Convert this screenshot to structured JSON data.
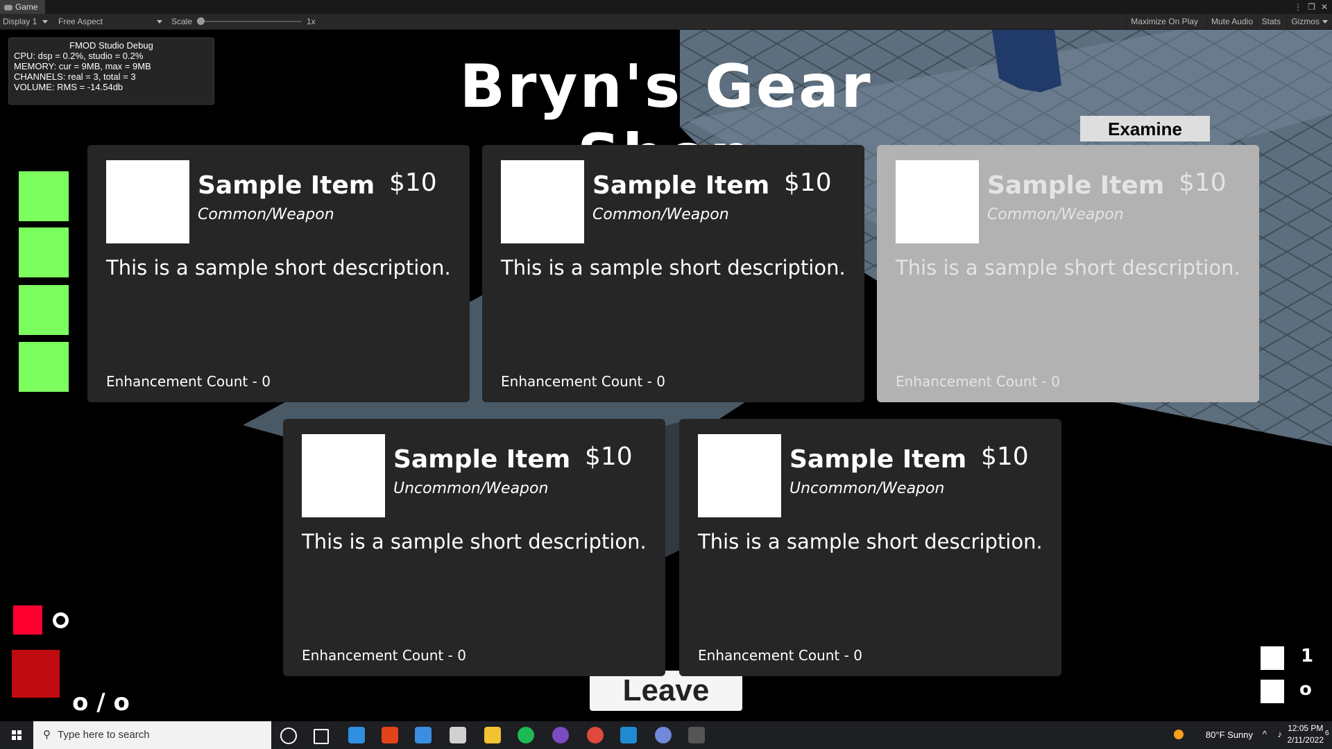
{
  "editor": {
    "tab_title": "Game",
    "display": "Display 1",
    "aspect": "Free Aspect",
    "scale_label": "Scale",
    "scale_value": "1x",
    "right_buttons": [
      "Maximize On Play",
      "Mute Audio",
      "Stats",
      "Gizmos"
    ]
  },
  "fmod": {
    "title": "FMOD Studio Debug",
    "lines": [
      "CPU: dsp = 0.2%, studio = 0.2%",
      "MEMORY: cur = 9MB, max = 9MB",
      "CHANNELS: real = 3, total = 3",
      "VOLUME: RMS = -14.54db"
    ]
  },
  "shop": {
    "title": "Bryn's Gear Shop",
    "examine_label": "Examine",
    "leave_label": "Leave",
    "items": [
      {
        "name": "Sample Item",
        "price": "$10",
        "rarity": "Common/Weapon",
        "description": "This is a sample short description.",
        "enhancement": "Enhancement Count - 0",
        "state": "normal"
      },
      {
        "name": "Sample Item",
        "price": "$10",
        "rarity": "Common/Weapon",
        "description": "This is a sample short description.",
        "enhancement": "Enhancement Count - 0",
        "state": "normal"
      },
      {
        "name": "Sample Item",
        "price": "$10",
        "rarity": "Common/Weapon",
        "description": "This is a sample short description.",
        "enhancement": "Enhancement Count - 0",
        "state": "highlighted"
      },
      {
        "name": "Sample Item",
        "price": "$10",
        "rarity": "Uncommon/Weapon",
        "description": "This is a sample short description.",
        "enhancement": "Enhancement Count - 0",
        "state": "normal"
      },
      {
        "name": "Sample Item",
        "price": "$10",
        "rarity": "Uncommon/Weapon",
        "description": "This is a sample short description.",
        "enhancement": "Enhancement Count - 0",
        "state": "normal"
      }
    ]
  },
  "hud": {
    "health_slots": 4,
    "health_color": "#7cff5e",
    "ratio_text": "o / o",
    "right_counts": [
      "1",
      "o"
    ]
  },
  "taskbar": {
    "search_placeholder": "Type here to search",
    "weather": "80°F  Sunny",
    "time": "12:05 PM",
    "date": "2/11/2022",
    "notification_count": "6"
  }
}
